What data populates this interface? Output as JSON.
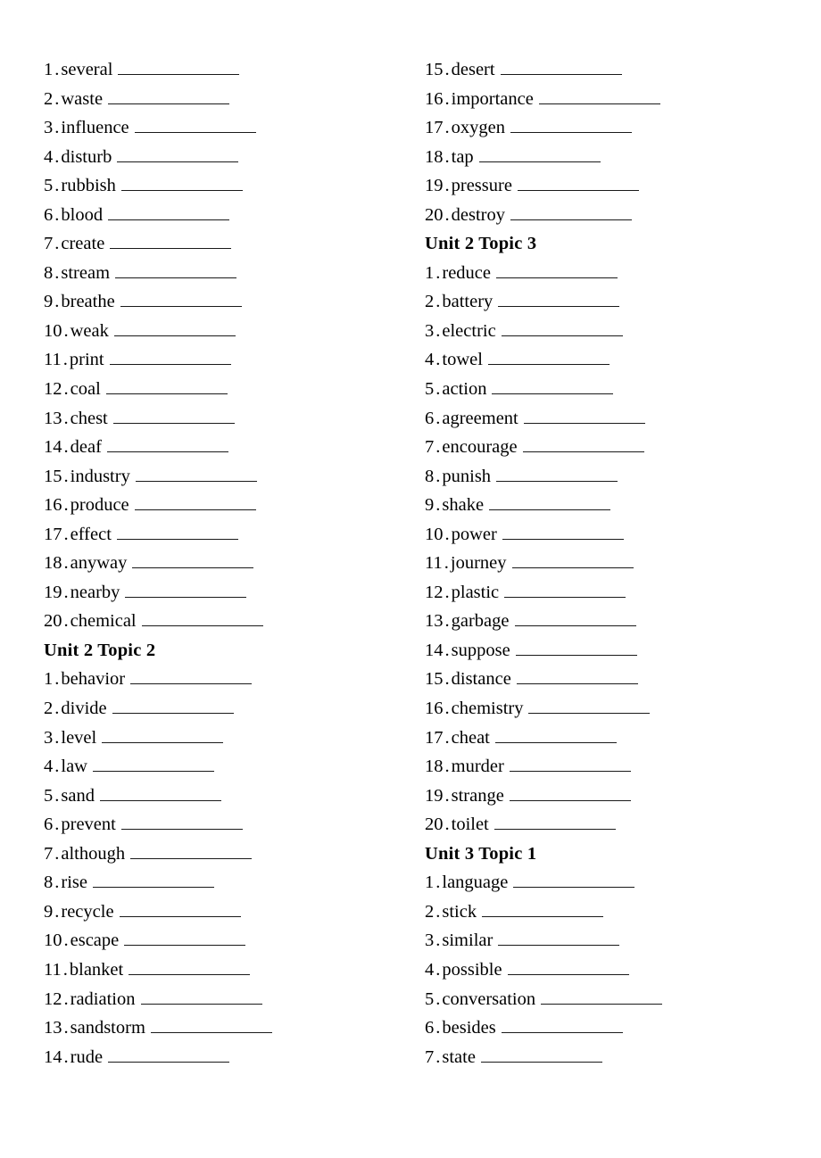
{
  "document": {
    "type": "vocabulary-worksheet",
    "separator": ".",
    "blank_style": "underline"
  },
  "columns": [
    {
      "id": "left",
      "blocks": [
        {
          "type": "list",
          "items": [
            {
              "number": "1",
              "word": "several"
            },
            {
              "number": "2",
              "word": "waste"
            },
            {
              "number": "3",
              "word": "influence"
            },
            {
              "number": "4",
              "word": "disturb"
            },
            {
              "number": "5",
              "word": "rubbish"
            },
            {
              "number": "6",
              "word": "blood"
            },
            {
              "number": "7",
              "word": "create"
            },
            {
              "number": "8",
              "word": "stream"
            },
            {
              "number": "9",
              "word": "breathe"
            },
            {
              "number": "10",
              "word": "weak"
            },
            {
              "number": "11",
              "word": "print"
            },
            {
              "number": "12",
              "word": "coal"
            },
            {
              "number": "13",
              "word": "chest"
            },
            {
              "number": "14",
              "word": "deaf"
            },
            {
              "number": "15",
              "word": "industry"
            },
            {
              "number": "16",
              "word": "produce"
            },
            {
              "number": "17",
              "word": "effect"
            },
            {
              "number": "18",
              "word": "anyway"
            },
            {
              "number": "19",
              "word": "nearby"
            },
            {
              "number": "20",
              "word": "chemical"
            }
          ]
        },
        {
          "type": "heading",
          "title": "Unit 2 Topic 2"
        },
        {
          "type": "list",
          "items": [
            {
              "number": "1",
              "word": "behavior"
            },
            {
              "number": "2",
              "word": "divide"
            },
            {
              "number": "3",
              "word": "level"
            },
            {
              "number": "4",
              "word": "law"
            },
            {
              "number": "5",
              "word": "sand"
            },
            {
              "number": "6",
              "word": "prevent"
            },
            {
              "number": "7",
              "word": "although"
            },
            {
              "number": "8",
              "word": "rise"
            },
            {
              "number": "9",
              "word": "recycle"
            },
            {
              "number": "10",
              "word": "escape"
            },
            {
              "number": "11",
              "word": "blanket"
            },
            {
              "number": "12",
              "word": "radiation"
            },
            {
              "number": "13",
              "word": "sandstorm"
            },
            {
              "number": "14",
              "word": "rude"
            }
          ]
        }
      ]
    },
    {
      "id": "right",
      "blocks": [
        {
          "type": "list",
          "items": [
            {
              "number": "15",
              "word": "desert"
            },
            {
              "number": "16",
              "word": "importance"
            },
            {
              "number": "17",
              "word": "oxygen"
            },
            {
              "number": "18",
              "word": "tap"
            },
            {
              "number": "19",
              "word": "pressure"
            },
            {
              "number": "20",
              "word": "destroy"
            }
          ]
        },
        {
          "type": "heading",
          "title": "Unit 2 Topic 3"
        },
        {
          "type": "list",
          "items": [
            {
              "number": "1",
              "word": "reduce"
            },
            {
              "number": "2",
              "word": "battery"
            },
            {
              "number": "3",
              "word": "electric"
            },
            {
              "number": "4",
              "word": "towel"
            },
            {
              "number": "5",
              "word": "action"
            },
            {
              "number": "6",
              "word": "agreement"
            },
            {
              "number": "7",
              "word": "encourage"
            },
            {
              "number": "8",
              "word": "punish"
            },
            {
              "number": "9",
              "word": "shake"
            },
            {
              "number": "10",
              "word": "power"
            },
            {
              "number": "11",
              "word": "journey"
            },
            {
              "number": "12",
              "word": "plastic"
            },
            {
              "number": "13",
              "word": "garbage"
            },
            {
              "number": "14",
              "word": "suppose"
            },
            {
              "number": "15",
              "word": "distance"
            },
            {
              "number": "16",
              "word": "chemistry"
            },
            {
              "number": "17",
              "word": "cheat"
            },
            {
              "number": "18",
              "word": "murder"
            },
            {
              "number": "19",
              "word": "strange"
            },
            {
              "number": "20",
              "word": "toilet"
            }
          ]
        },
        {
          "type": "heading",
          "title": "Unit 3 Topic 1"
        },
        {
          "type": "list",
          "items": [
            {
              "number": "1",
              "word": "language"
            },
            {
              "number": "2",
              "word": "stick"
            },
            {
              "number": "3",
              "word": "similar"
            },
            {
              "number": "4",
              "word": "possible"
            },
            {
              "number": "5",
              "word": "conversation"
            },
            {
              "number": "6",
              "word": "besides"
            },
            {
              "number": "7",
              "word": "state"
            }
          ]
        }
      ]
    }
  ]
}
